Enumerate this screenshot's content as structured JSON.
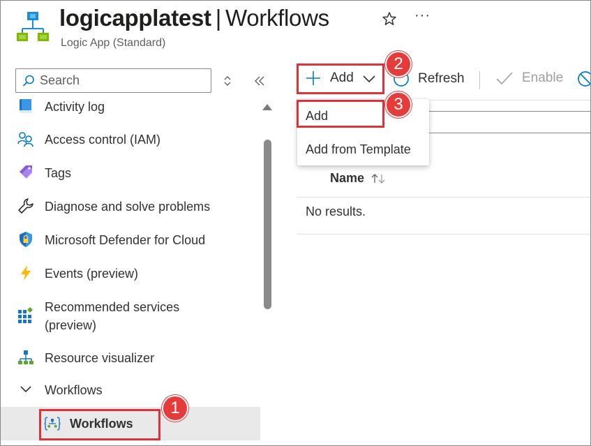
{
  "header": {
    "resource_name": "logicapplatest",
    "separator": "|",
    "page_name": "Workflows",
    "subtitle": "Logic App (Standard)",
    "more_label": "···"
  },
  "sidebar": {
    "search_placeholder": "Search",
    "items": [
      {
        "label": "Activity log",
        "icon": "activity-log-icon"
      },
      {
        "label": "Access control (IAM)",
        "icon": "people-icon"
      },
      {
        "label": "Tags",
        "icon": "tag-icon"
      },
      {
        "label": "Diagnose and solve problems",
        "icon": "wrench-icon"
      },
      {
        "label": "Microsoft Defender for Cloud",
        "icon": "shield-icon"
      },
      {
        "label": "Events (preview)",
        "icon": "lightning-icon"
      },
      {
        "label": "Recommended services (preview)",
        "icon": "grid-icon"
      },
      {
        "label": "Resource visualizer",
        "icon": "hierarchy-icon"
      },
      {
        "label": "Workflows",
        "icon": "chevron-down-icon"
      },
      {
        "label": "Workflows",
        "icon": "workflow-icon"
      }
    ]
  },
  "toolbar": {
    "add_label": "Add",
    "refresh_label": "Refresh",
    "enable_label": "Enable"
  },
  "dropdown": {
    "items": [
      "Add",
      "Add from Template"
    ]
  },
  "table": {
    "columns": [
      "Name"
    ],
    "empty_text": "No results."
  },
  "annotations": {
    "badges": [
      "1",
      "2",
      "3"
    ],
    "color": "#e53b3b"
  },
  "colors": {
    "accent": "#0078d4",
    "highlight": "#e0303a",
    "selected_bg": "#e9e9e9"
  }
}
